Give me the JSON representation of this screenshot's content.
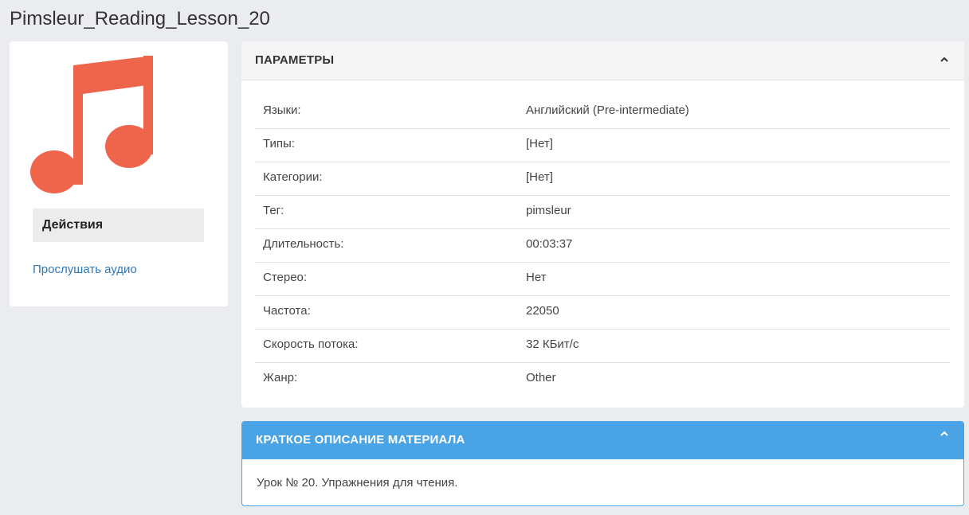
{
  "page": {
    "title": "Pimsleur_Reading_Lesson_20"
  },
  "left": {
    "icon": "music-note-icon",
    "icon_color": "#ee654b",
    "actions_label": "Действия",
    "listen_label": "Прослушать аудио"
  },
  "params": {
    "title": "ПАРАМЕТРЫ",
    "collapse_icon": "chevron-up-icon",
    "rows": [
      {
        "key": "Языки:",
        "value": "Английский (Pre-intermediate)"
      },
      {
        "key": "Типы:",
        "value": "[Нет]"
      },
      {
        "key": "Категории:",
        "value": "[Нет]"
      },
      {
        "key": "Тег:",
        "value": "pimsleur"
      },
      {
        "key": "Длительность:",
        "value": "00:03:37"
      },
      {
        "key": "Стерео:",
        "value": "Нет"
      },
      {
        "key": "Частота:",
        "value": "22050"
      },
      {
        "key": "Скорость потока:",
        "value": "32 КБит/с"
      },
      {
        "key": "Жанр:",
        "value": "Other"
      }
    ]
  },
  "description": {
    "title": "КРАТКОЕ ОПИСАНИЕ МАТЕРИАЛА",
    "collapse_icon": "chevron-up-icon",
    "text": "Урок № 20. Упражнения для чтения.",
    "accent_color": "#4aa3e4"
  }
}
